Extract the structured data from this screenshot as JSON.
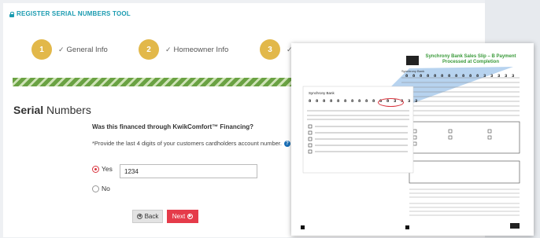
{
  "header": {
    "title": "REGISTER SERIAL NUMBERS TOOL"
  },
  "steps": [
    {
      "number": "1",
      "label": "General Info"
    },
    {
      "number": "2",
      "label": "Homeowner Info"
    },
    {
      "number": "3",
      "label": ""
    }
  ],
  "section": {
    "title_bold": "Serial",
    "title_rest": " Numbers"
  },
  "form": {
    "question": "Was this financed through KwikComfort™ Financing?",
    "instruction": "*Provide the last 4 digits of your customers cardholders account number.",
    "yes_label": "Yes",
    "no_label": "No",
    "digits_value": "1234",
    "selected": "Yes"
  },
  "buttons": {
    "back": "Back",
    "next": "Next"
  },
  "slip": {
    "title": "Synchrony Bank Sales Slip – B Payment Processed at Completion",
    "bank_name": "Synchrony Bank",
    "account_digits_top": "8 8 8 8 8 8 8 8 8 8 8 3 3 3 3 3",
    "account_digits_left": "8 8 8 8 8 8 8 8 8 8 8 8 3 3 3 3"
  }
}
